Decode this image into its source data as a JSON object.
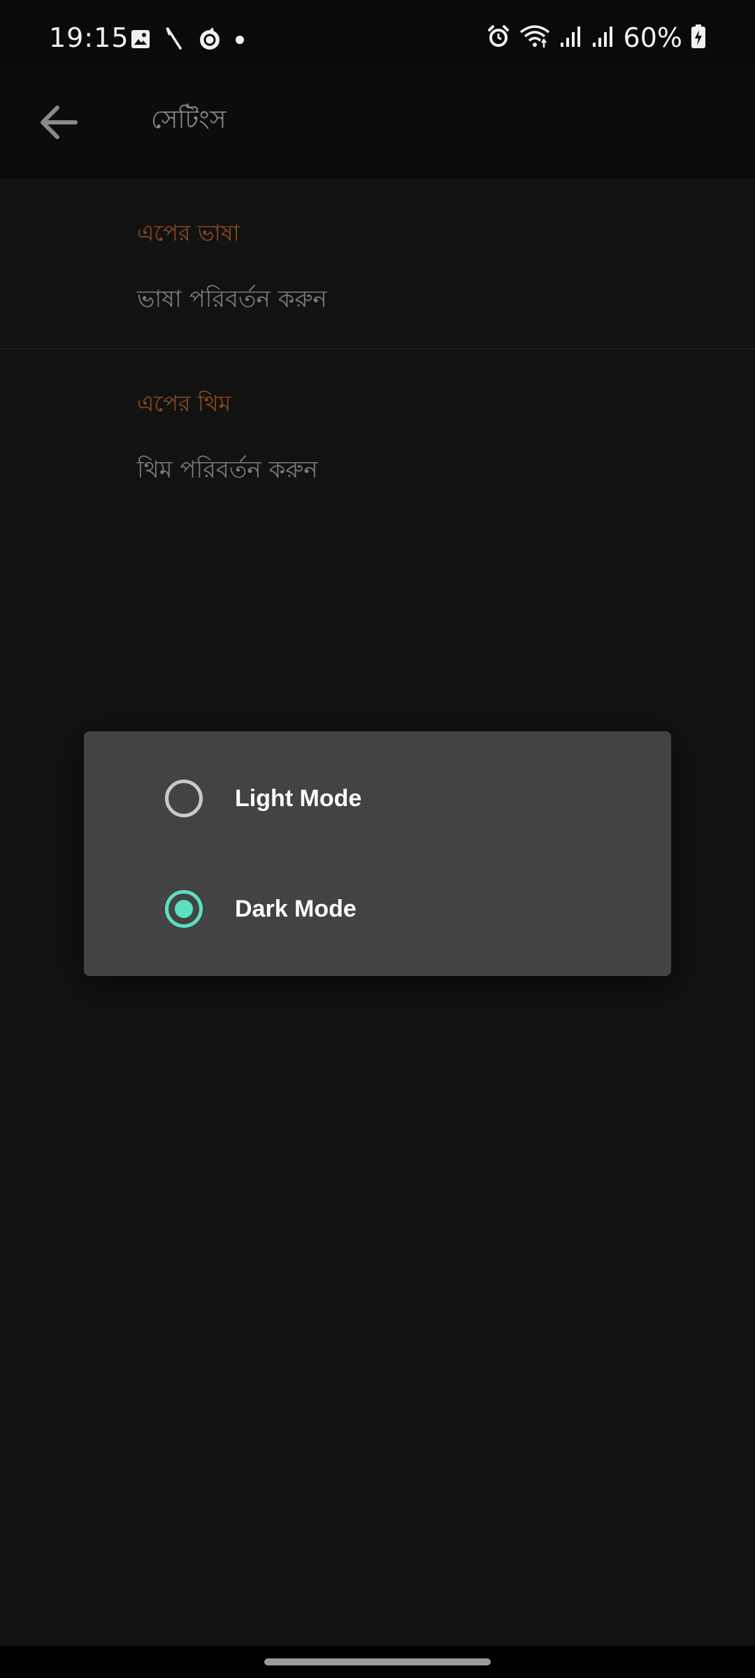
{
  "status_bar": {
    "time": "19:15",
    "left_icons": [
      "gallery-icon",
      "stylus-icon",
      "app-notification-icon",
      "dot-icon"
    ],
    "right_icons": [
      "alarm-icon",
      "wifi-icon",
      "signal-icon-1",
      "signal-icon-2"
    ],
    "battery": "60%"
  },
  "app_bar": {
    "title": "সেটিংস",
    "back_icon": "arrow-left-icon"
  },
  "settings": {
    "sections": [
      {
        "header": "এপের ভাষা",
        "item": "ভাষা পরিবর্তন করুন"
      },
      {
        "header": "এপের থিম",
        "item": "থিম পরিবর্তন করুন"
      }
    ]
  },
  "theme_dialog": {
    "options": [
      {
        "label": "Light Mode",
        "selected": false
      },
      {
        "label": "Dark Mode",
        "selected": true
      }
    ]
  },
  "colors": {
    "accent": "#5be0c0",
    "section_header": "#8a4a1f",
    "dialog_bg": "#434343",
    "background": "#121212"
  }
}
